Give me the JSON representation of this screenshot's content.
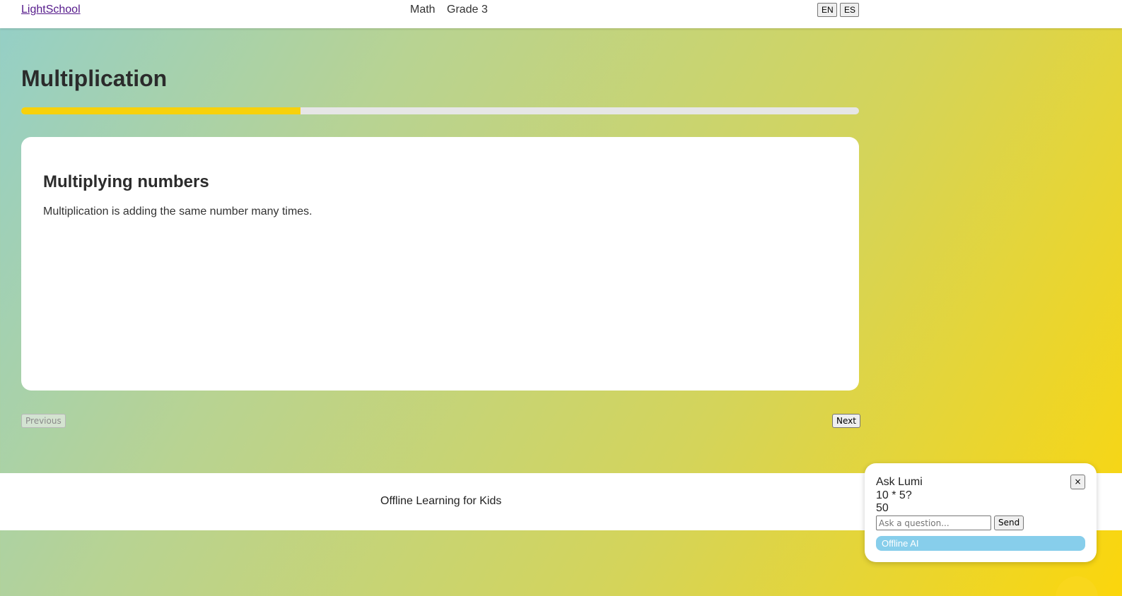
{
  "header": {
    "brand": "LightSchool",
    "subject": "Math",
    "grade": "Grade 3",
    "languages": [
      "EN",
      "ES"
    ]
  },
  "lesson": {
    "title": "Multiplication",
    "progress_fraction": 0.333
  },
  "card": {
    "heading": "Multiplying numbers",
    "body": "Multiplication is adding the same number many times."
  },
  "nav": {
    "previous_label": "Previous",
    "next_label": "Next"
  },
  "footer": {
    "text": "Offline Learning for Kids"
  },
  "assistant": {
    "title": "Ask Lumi",
    "close_label": "×",
    "question": "10 * 5?",
    "answer": "50",
    "input_placeholder": "Ask a question...",
    "send_label": "Send",
    "mode_label": "Offline AI"
  },
  "colors": {
    "progress_fill": "#f7d10b",
    "mode_badge": "#87ceeb"
  }
}
